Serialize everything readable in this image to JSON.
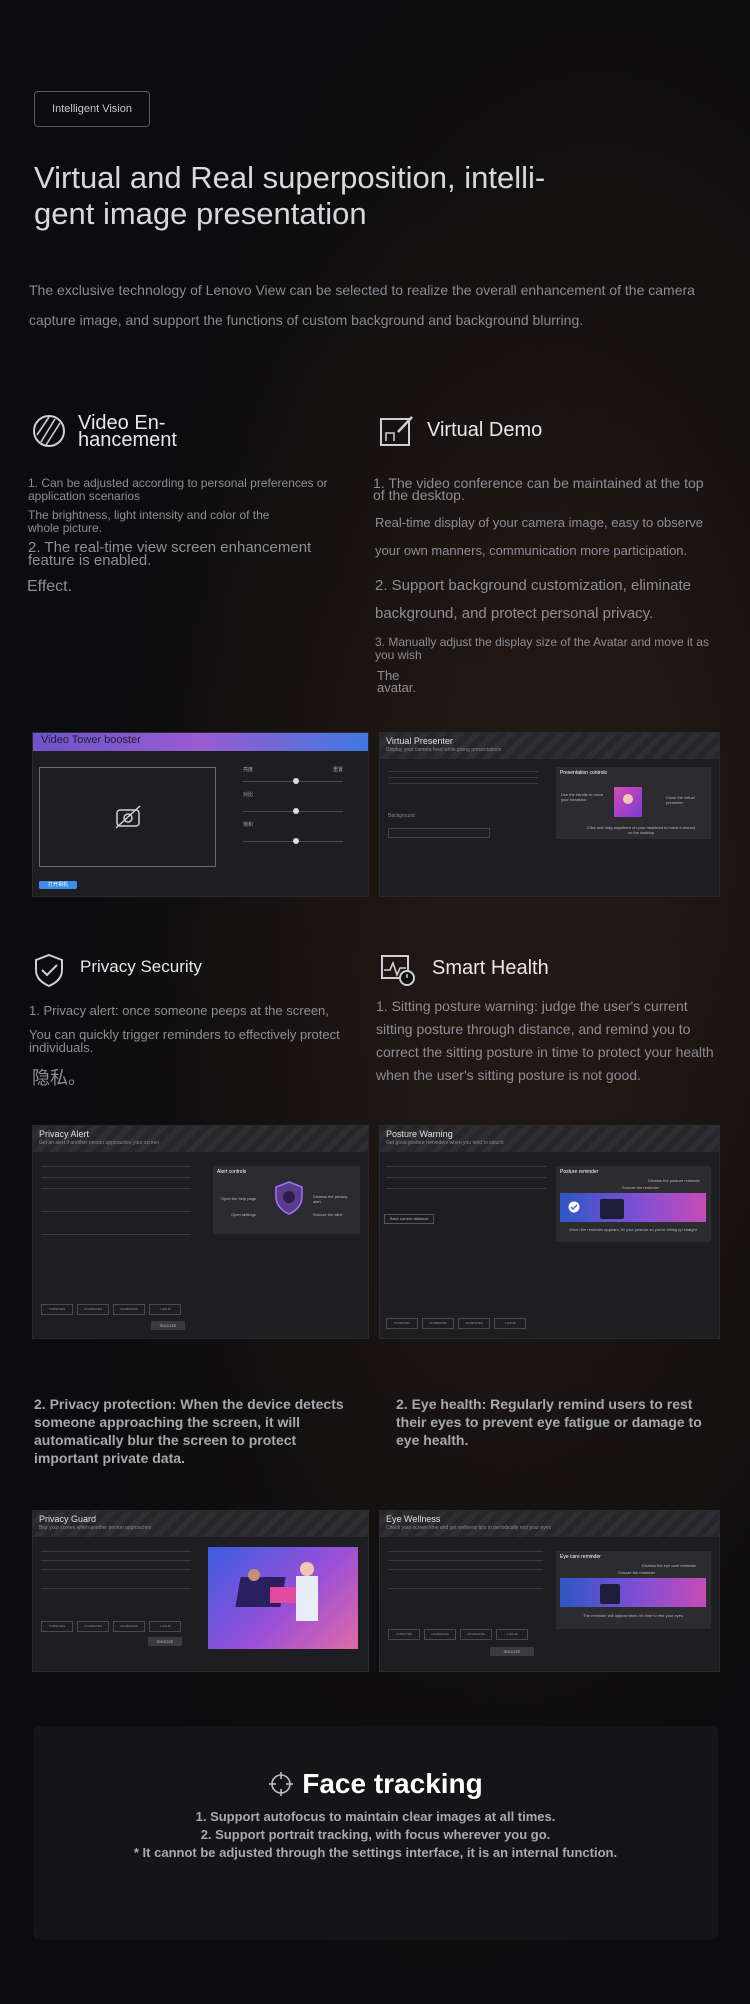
{
  "badge": "Intelligent Vision",
  "hero": {
    "title": "Virtual and Real superposition, intelli-gent image presentation",
    "description": "The exclusive technology of Lenovo View can be selected to realize the overall enhancement of the camera capture image, and support the functions of custom background and background blurring."
  },
  "video_enhancement": {
    "title_line1": "Video En-",
    "title_line2": "hancement",
    "p1": "1. Can be adjusted according to personal preferences or application scenarios",
    "p2": "The brightness, light intensity and color of the whole picture.",
    "p3": "2. The real-time view screen enhancement feature is enabled.",
    "p4": "Effect."
  },
  "virtual_demo": {
    "title": "Virtual Demo",
    "p1": "1. The video conference can be maintained at the top of the desktop.",
    "p2": "Real-time display of your camera image, easy to observe your own manners, communication more participation.",
    "p3": "2. Support background customization, eliminate background, and protect personal privacy.",
    "p4": "3. Manually adjust the display size of the Avatar and move it as you wish",
    "p5": "The",
    "p6": "avatar."
  },
  "shot_video_tower": {
    "title": "Video Tower booster",
    "button": "打开相机",
    "label_top_right": "重置",
    "labels": [
      "亮度",
      "对比",
      "饱和",
      "锐利"
    ]
  },
  "shot_virtual_presenter": {
    "title": "Virtual Presenter",
    "toggle_text": "Display your camera feed while giving presentations",
    "section": "Presentation controls",
    "callout_left": "Use the handle to move your headshot",
    "callout_right": "Close the virtual presenter",
    "callout_bottom": "Click and drag anywhere on your headshot to move it around on the desktop",
    "field_label": "Background"
  },
  "privacy_security": {
    "title": "Privacy Security",
    "p1": "1. Privacy alert: once someone peeps at the screen,",
    "p2": "You can quickly trigger reminders to effectively protect individuals.",
    "p3": "隐私。"
  },
  "smart_health": {
    "title": "Smart Health",
    "p1": "1. Sitting posture warning: judge the user's current sitting posture through distance, and remind you to correct the sitting posture in time to protect your health when the user's sitting posture is not good."
  },
  "shot_privacy_alert": {
    "title": "Privacy Alert",
    "toggle_text": "Get an alert if another person approaches your screen",
    "section": "Alert controls",
    "callouts": [
      "Open the help page",
      "Open settings",
      "Dismiss the privacy alert",
      "Snooze the alert"
    ],
    "buttons": [
      "5 MINUTES",
      "15 MINUTES",
      "30 MINUTES",
      "1 HOUR"
    ],
    "action": "SNOOZE"
  },
  "shot_posture_warning": {
    "title": "Posture Warning",
    "toggle_text": "Get good posture reminders when you tend to slouch",
    "section": "Posture reminder",
    "callouts": [
      "Dismiss the posture reminder",
      "Snooze the reminder"
    ],
    "footer": "When the reminder appears, fix your posture so you're sitting up straight",
    "button": "Save current distance",
    "buttons": [
      "5 MINUTES",
      "15 MINUTES",
      "30 MINUTES",
      "1 HOUR"
    ]
  },
  "privacy_protection": "2. Privacy protection: When the device detects someone approaching the screen, it will automatically blur the screen to protect important private data.",
  "eye_health": "2. Eye health: Regularly remind users to rest their eyes to prevent eye fatigue or damage to eye health.",
  "shot_privacy_guard": {
    "title": "Privacy Guard",
    "toggle_text": "Blur your screen when another person approaches",
    "buttons": [
      "5 MINUTES",
      "15 MINUTES",
      "30 MINUTES",
      "1 HOUR"
    ],
    "action": "SNOOZE"
  },
  "shot_eye_wellness": {
    "title": "Eye Wellness",
    "toggle_text": "Check your screen time and get wellness tips to periodically rest your eyes",
    "section": "Eye care reminder",
    "callouts": [
      "Dismiss the eye care reminder",
      "Snooze the reminder"
    ],
    "footer": "The reminder will appear when it's time to rest your eyes",
    "buttons": [
      "5 MINUTES",
      "15 MINUTES",
      "30 MINUTES",
      "1 HOUR"
    ],
    "action": "SNOOZE"
  },
  "face_tracking": {
    "title": "Face tracking",
    "line1": "1. Support autofocus to maintain clear images at all times.",
    "line2": "2. Support portrait tracking, with focus wherever you go.",
    "line3": "* It cannot be adjusted through the settings interface, it is an internal function."
  }
}
